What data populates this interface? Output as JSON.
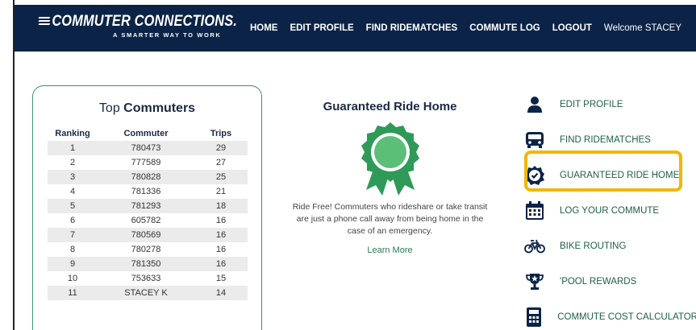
{
  "header": {
    "logo_main": "COMMUTER CONNECTIONS.",
    "logo_sub": "A SMARTER WAY TO WORK",
    "nav": [
      "HOME",
      "EDIT PROFILE",
      "FIND RIDEMATCHES",
      "COMMUTE LOG",
      "LOGOUT"
    ],
    "welcome": "Welcome STACEY"
  },
  "top_commuters": {
    "title_light": "Top",
    "title_bold": "Commuters",
    "columns": [
      "Ranking",
      "Commuter",
      "Trips"
    ],
    "rows": [
      [
        "1",
        "780473",
        "29"
      ],
      [
        "2",
        "777589",
        "27"
      ],
      [
        "3",
        "780828",
        "25"
      ],
      [
        "4",
        "781336",
        "21"
      ],
      [
        "5",
        "781293",
        "18"
      ],
      [
        "6",
        "605782",
        "16"
      ],
      [
        "7",
        "780569",
        "16"
      ],
      [
        "8",
        "780278",
        "16"
      ],
      [
        "9",
        "781350",
        "16"
      ],
      [
        "10",
        "753633",
        "15"
      ],
      [
        "11",
        "STACEY K",
        "14"
      ]
    ]
  },
  "guaranteed": {
    "title": "Guaranteed Ride Home",
    "text": "Ride Free! Commuters who rideshare or take transit are just a phone call away from being home in the case of an emergency.",
    "link": "Learn More"
  },
  "menu": {
    "items": [
      {
        "label": "EDIT PROFILE",
        "icon": "person-icon"
      },
      {
        "label": "FIND RIDEMATCHES",
        "icon": "bus-icon"
      },
      {
        "label": "GUARANTEED RIDE HOME",
        "icon": "badge-check-icon"
      },
      {
        "label": "LOG YOUR COMMUTE",
        "icon": "calendar-icon"
      },
      {
        "label": "BIKE ROUTING",
        "icon": "bicycle-icon"
      },
      {
        "label": "'POOL REWARDS",
        "icon": "trophy-icon"
      },
      {
        "label": "COMMUTE COST CALCULATOR",
        "icon": "calculator-icon"
      }
    ]
  },
  "colors": {
    "navy": "#0b2347",
    "green": "#2f9a58",
    "highlight": "#f2b600"
  }
}
